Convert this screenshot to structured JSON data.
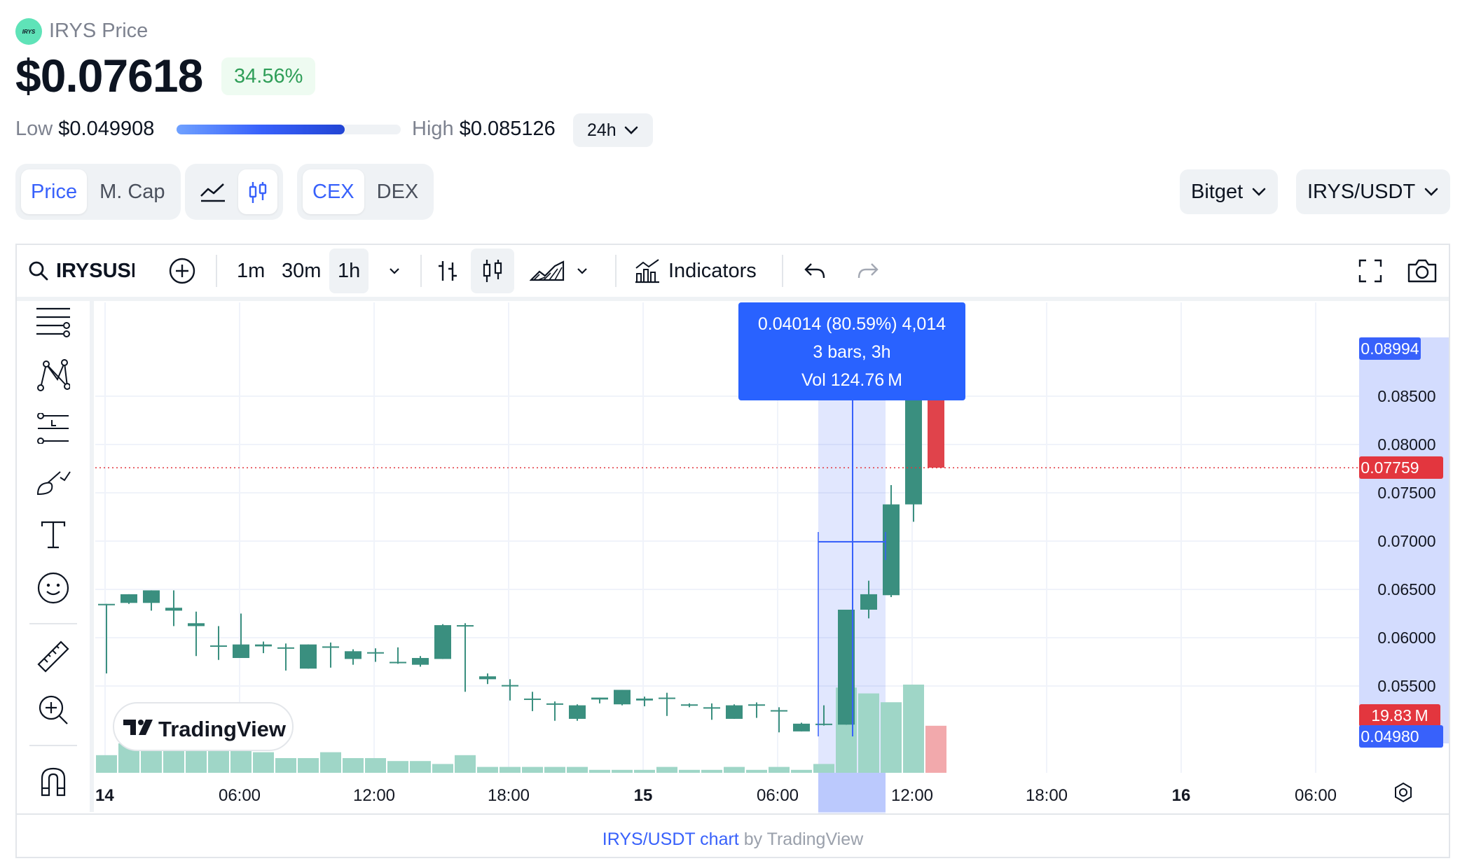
{
  "header": {
    "logo_text": "IRYS",
    "title": "IRYS Price",
    "price": "$0.07618",
    "change": "34.56%",
    "low_label": "Low",
    "low_value": "$0.049908",
    "high_label": "High",
    "high_value": "$0.085126",
    "range_fill_fraction": 0.75,
    "period": "24h"
  },
  "toggles": {
    "metric": [
      "Price",
      "M. Cap"
    ],
    "metric_active": "Price",
    "chart_style_icons": [
      "line-chart-icon",
      "candlestick-icon"
    ],
    "market": [
      "CEX",
      "DEX"
    ],
    "market_active": "CEX"
  },
  "selectors": {
    "exchange": "Bitget",
    "pair": "IRYS/USDT"
  },
  "toolbar": {
    "symbol": "IRYSUSDT",
    "intervals": [
      "1m",
      "30m",
      "1h"
    ],
    "active_interval": "1h",
    "indicators_label": "Indicators"
  },
  "left_tools": [
    "lines-icon",
    "pattern-icon",
    "fib-icon",
    "brush-icon",
    "text-icon",
    "emoji-icon",
    "ruler-icon",
    "zoom-in-icon",
    "magnet-icon"
  ],
  "tooltip": {
    "line1": "0.04014 (80.59%) 4,014",
    "line2": "3 bars, 3h",
    "line3": "Vol 124.76 M"
  },
  "footer": {
    "link": "IRYS/USDT chart",
    "by": "by TradingView"
  },
  "watermark": "TradingView",
  "chart_data": {
    "type": "candlestick",
    "y_ticks": [
      0.055,
      0.06,
      0.065,
      0.07,
      0.075,
      0.08,
      0.085
    ],
    "y_tick_labels": [
      "0.05500",
      "0.06000",
      "0.06500",
      "0.07000",
      "0.07500",
      "0.08000",
      "0.08500"
    ],
    "x_ticks": [
      "14",
      "06:00",
      "12:00",
      "18:00",
      "15",
      "06:00",
      "12:00",
      "18:00",
      "16",
      "06:00"
    ],
    "price_labels": {
      "top": "0.08994",
      "last": "0.07759",
      "volume": "19.83 M",
      "bottom": "0.04980"
    },
    "last_price": 0.07759,
    "candles": [
      [
        0.0635,
        0.0635,
        0.0567,
        0.0563,
        6
      ],
      [
        0.0636,
        0.0645,
        0.0635,
        0.0636,
        10
      ],
      [
        0.0636,
        0.0649,
        0.0631,
        0.0628,
        8
      ],
      [
        0.0628,
        0.0631,
        0.0649,
        0.0612,
        9
      ],
      [
        0.0612,
        0.0615,
        0.0627,
        0.0581,
        16
      ],
      [
        0.0592,
        0.0592,
        0.0612,
        0.0577,
        8
      ],
      [
        0.0579,
        0.0593,
        0.0579,
        0.0625,
        11
      ],
      [
        0.0591,
        0.0593,
        0.0596,
        0.0584,
        7
      ],
      [
        0.059,
        0.059,
        0.0594,
        0.0566,
        5
      ],
      [
        0.0568,
        0.0593,
        0.0568,
        0.0591,
        5
      ],
      [
        0.0591,
        0.0591,
        0.0595,
        0.0569,
        7
      ],
      [
        0.0578,
        0.0586,
        0.0572,
        0.0588,
        5
      ],
      [
        0.0585,
        0.0585,
        0.0589,
        0.0575,
        5
      ],
      [
        0.0575,
        0.0575,
        0.059,
        0.0573,
        4
      ],
      [
        0.0572,
        0.0579,
        0.057,
        0.0581,
        4
      ],
      [
        0.0578,
        0.0613,
        0.0578,
        0.0614,
        3
      ],
      [
        0.0613,
        0.0613,
        0.0615,
        0.0544,
        6
      ],
      [
        0.0557,
        0.056,
        0.0552,
        0.0563,
        2
      ],
      [
        0.0551,
        0.0551,
        0.0557,
        0.0535,
        2
      ],
      [
        0.0537,
        0.0537,
        0.0544,
        0.0524,
        2
      ],
      [
        0.0532,
        0.0532,
        0.0534,
        0.0514,
        2
      ],
      [
        0.0516,
        0.053,
        0.0514,
        0.0531,
        2
      ],
      [
        0.0536,
        0.0538,
        0.0534,
        0.0532,
        1
      ],
      [
        0.0531,
        0.0546,
        0.053,
        0.0531,
        1
      ],
      [
        0.0535,
        0.0537,
        0.0539,
        0.0529,
        1
      ],
      [
        0.0538,
        0.0538,
        0.0543,
        0.0519,
        2
      ],
      [
        0.053,
        0.0531,
        0.0528,
        0.0532,
        1
      ],
      [
        0.0528,
        0.0528,
        0.0532,
        0.0515,
        1
      ],
      [
        0.0516,
        0.053,
        0.0516,
        0.0531,
        2
      ],
      [
        0.0531,
        0.0531,
        0.0533,
        0.0517,
        1
      ],
      [
        0.0525,
        0.0525,
        0.0528,
        0.0502,
        2
      ],
      [
        0.0503,
        0.0511,
        0.0503,
        0.0512,
        1
      ],
      [
        0.051,
        0.0511,
        0.0509,
        0.053,
        3
      ],
      [
        0.051,
        0.0629,
        0.051,
        0.0629,
        29
      ],
      [
        0.0629,
        0.0645,
        0.062,
        0.0659,
        27
      ],
      [
        0.0644,
        0.0738,
        0.0642,
        0.0758,
        24
      ],
      [
        0.0738,
        0.086,
        0.072,
        0.089,
        30
      ],
      [
        0.086,
        0.0776,
        0.086,
        0.0776,
        16
      ]
    ]
  }
}
